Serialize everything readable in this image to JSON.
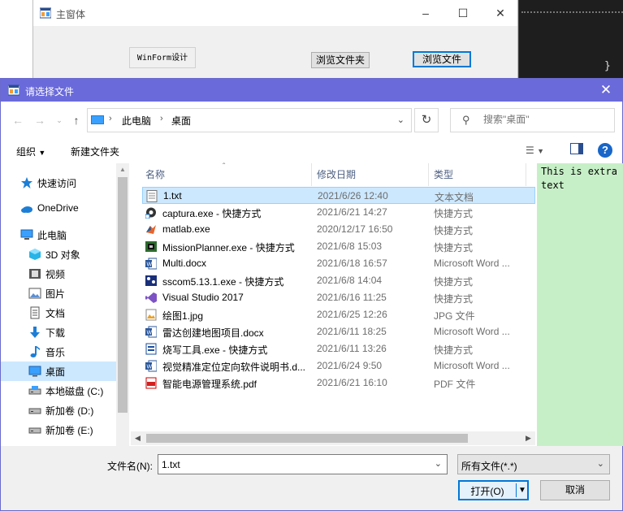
{
  "main_window": {
    "title": "主窗体",
    "groupbox_label": "WinForm设计",
    "browse_folder_button": "浏览文件夹",
    "browse_file_button": "浏览文件"
  },
  "dialog": {
    "title": "请选择文件",
    "breadcrumb": [
      "此电脑",
      "桌面"
    ],
    "search_placeholder": "搜索\"桌面\"",
    "toolbar": {
      "organize": "组织",
      "new_folder": "新建文件夹"
    },
    "nav_items": [
      {
        "label": "快速访问",
        "icon": "quick-access-star-icon",
        "selected": false
      },
      {
        "label": "OneDrive",
        "icon": "onedrive-cloud-icon",
        "selected": false
      },
      {
        "label": "此电脑",
        "icon": "this-pc-icon",
        "selected": false
      },
      {
        "label": "3D 对象",
        "icon": "3d-objects-icon",
        "selected": false
      },
      {
        "label": "视频",
        "icon": "videos-icon",
        "selected": false
      },
      {
        "label": "图片",
        "icon": "pictures-icon",
        "selected": false
      },
      {
        "label": "文档",
        "icon": "documents-icon",
        "selected": false
      },
      {
        "label": "下载",
        "icon": "downloads-icon",
        "selected": false
      },
      {
        "label": "音乐",
        "icon": "music-icon",
        "selected": false
      },
      {
        "label": "桌面",
        "icon": "desktop-icon",
        "selected": true
      },
      {
        "label": "本地磁盘 (C:)",
        "icon": "drive-icon",
        "selected": false
      },
      {
        "label": "新加卷 (D:)",
        "icon": "drive-icon",
        "selected": false
      },
      {
        "label": "新加卷 (E:)",
        "icon": "drive-icon",
        "selected": false
      }
    ],
    "columns": {
      "name": "名称",
      "date": "修改日期",
      "type": "类型"
    },
    "files": [
      {
        "name": "1.txt",
        "date": "2021/6/26 12:40",
        "type": "文本文档",
        "icon": "text-file-icon",
        "selected": true
      },
      {
        "name": "captura.exe - 快捷方式",
        "date": "2021/6/21 14:27",
        "type": "快捷方式",
        "icon": "captura-shortcut-icon",
        "selected": false
      },
      {
        "name": "matlab.exe",
        "date": "2020/12/17 16:50",
        "type": "快捷方式",
        "icon": "matlab-icon",
        "selected": false
      },
      {
        "name": "MissionPlanner.exe - 快捷方式",
        "date": "2021/6/8 15:03",
        "type": "快捷方式",
        "icon": "missionplanner-icon",
        "selected": false
      },
      {
        "name": "Multi.docx",
        "date": "2021/6/18 16:57",
        "type": "Microsoft Word ...",
        "icon": "word-doc-icon",
        "selected": false
      },
      {
        "name": "sscom5.13.1.exe - 快捷方式",
        "date": "2021/6/8 14:04",
        "type": "快捷方式",
        "icon": "sscom-icon",
        "selected": false
      },
      {
        "name": "Visual Studio 2017",
        "date": "2021/6/16 11:25",
        "type": "快捷方式",
        "icon": "visual-studio-icon",
        "selected": false
      },
      {
        "name": "绘图1.jpg",
        "date": "2021/6/25 12:26",
        "type": "JPG 文件",
        "icon": "jpg-image-icon",
        "selected": false
      },
      {
        "name": "雷达创建地图项目.docx",
        "date": "2021/6/11 18:25",
        "type": "Microsoft Word ...",
        "icon": "word-doc-icon",
        "selected": false
      },
      {
        "name": "烧写工具.exe - 快捷方式",
        "date": "2021/6/11 13:26",
        "type": "快捷方式",
        "icon": "burn-tool-icon",
        "selected": false
      },
      {
        "name": "视觉精准定位定向软件说明书.d...",
        "date": "2021/6/24 9:50",
        "type": "Microsoft Word ...",
        "icon": "word-doc-icon",
        "selected": false
      },
      {
        "name": "智能电源管理系统.pdf",
        "date": "2021/6/21 16:10",
        "type": "PDF 文件",
        "icon": "pdf-icon",
        "selected": false
      }
    ],
    "preview_text": "This is extra text",
    "filename_label": "文件名(N):",
    "filename_value": "1.txt",
    "filetype_value": "所有文件(*.*)",
    "open_button": "打开(O)",
    "cancel_button": "取消"
  },
  "colors": {
    "dialog_title_bar": "#6a6adb",
    "selection": "#cce8ff",
    "preview_bg": "#c7efc7",
    "accent": "#0078d7"
  }
}
